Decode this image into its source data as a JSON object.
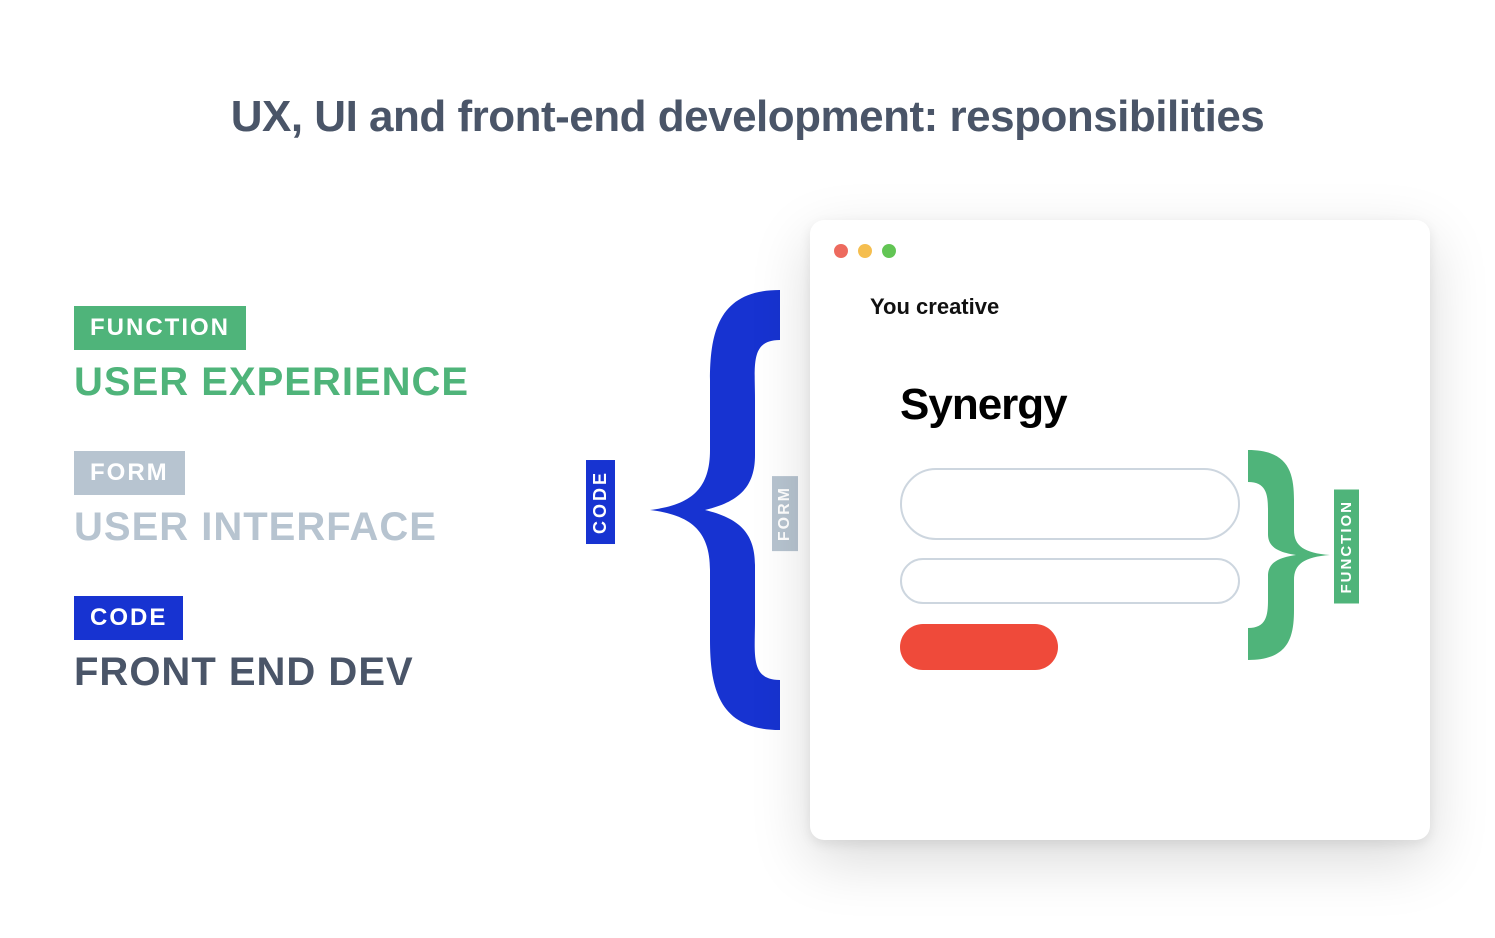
{
  "title": "UX, UI and front-end development: responsibilities",
  "legend": {
    "function_tag": "FUNCTION",
    "function_big": "USER EXPERIENCE",
    "form_tag": "FORM",
    "form_big": "USER INTERFACE",
    "code_tag": "CODE",
    "code_big": "FRONT END DEV"
  },
  "braces": {
    "code_label": "CODE",
    "form_label": "FORM",
    "function_label": "FUNCTION"
  },
  "window": {
    "subtitle": "You creative",
    "title": "Synergy"
  },
  "colors": {
    "green": "#4fb47a",
    "grey": "#b7c4d0",
    "blue": "#1733d1",
    "slate": "#4a5568",
    "red": "#ef4a3a"
  }
}
